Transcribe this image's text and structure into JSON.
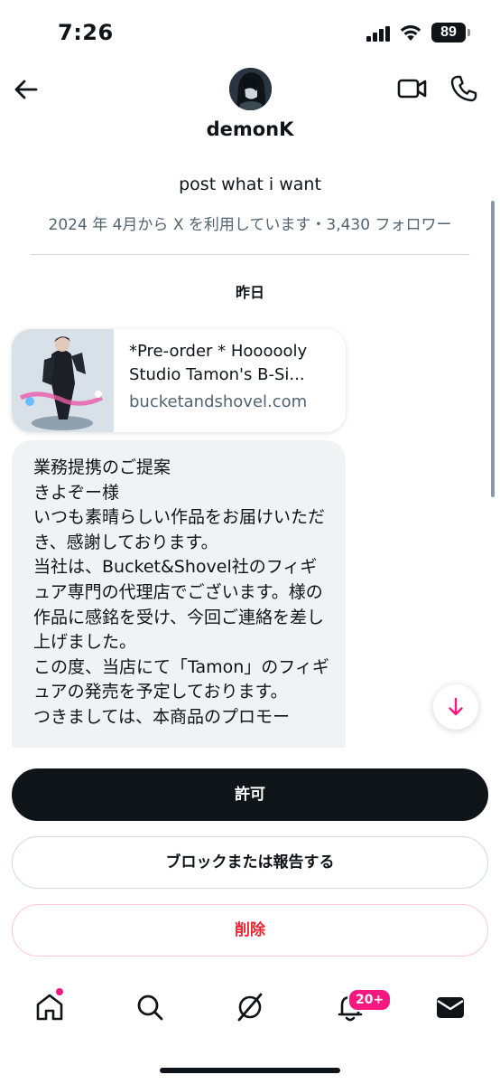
{
  "status_bar": {
    "time": "7:26",
    "battery": "89"
  },
  "header": {
    "back_icon": "arrow-left-icon",
    "name": "demonK",
    "video_icon": "video-camera-icon",
    "call_icon": "phone-icon"
  },
  "profile": {
    "bio": "post what i want",
    "meta": "2024 年 4月から X を利用しています・3,430 フォロワー"
  },
  "conversation": {
    "date_label": "昨日",
    "link_card": {
      "title_line1": "*Pre-order * Hoooooly",
      "title_line2": "Studio Tamon's B-Si...",
      "domain": "bucketandshovel.com"
    },
    "message": "業務提携のご提案\nきよぞー様\nいつも素晴らしい作品をお届けいただき、感謝しております。\n当社は、Bucket&Shovel社のフィギュア専門の代理店でございます。様の作品に感銘を受け、今回ご連絡を差し上げました。\nこの度、当店にて「Tamon」のフィギュアの発売を予定しております。\nつきましては、本商品のプロモー"
  },
  "actions": {
    "allow_label": "許可",
    "block_label": "ブロックまたは報告する",
    "delete_label": "削除"
  },
  "tabbar": {
    "items": [
      "home-icon",
      "search-icon",
      "grok-icon",
      "bell-icon",
      "mail-icon"
    ],
    "notification_badge": "20+"
  },
  "colors": {
    "accent_pink": "#f91880",
    "delete_red": "#f4212e",
    "secondary_text": "#536471",
    "bubble_bg": "#eff3f4"
  }
}
